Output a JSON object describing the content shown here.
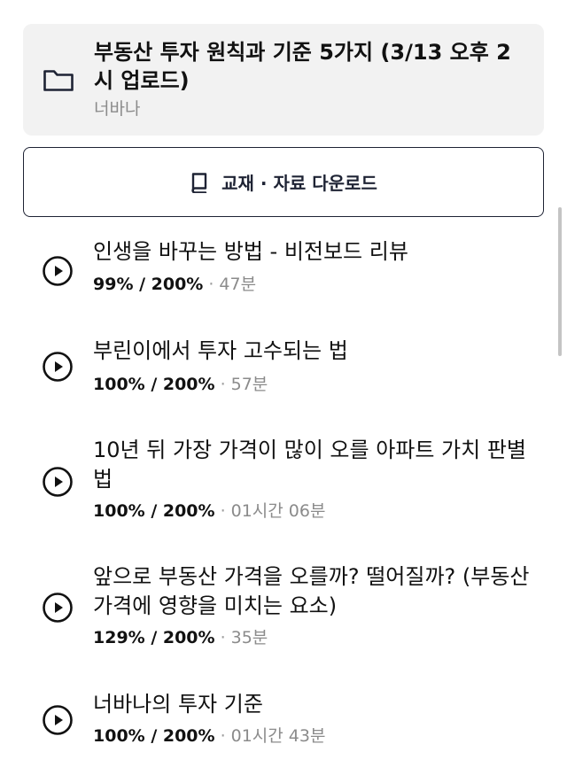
{
  "course": {
    "icon": "folder-icon",
    "title": "부동산 투자 원칙과 기준 5가지 (3/13 오후 2시 업로드)",
    "author": "너바나"
  },
  "download": {
    "icon": "book-icon",
    "label": "교재 · 자료 다운로드"
  },
  "lessons": [
    {
      "icon": "play-icon",
      "title": "인생을 바꾸는 방법 - 비전보드 리뷰",
      "progress": "99% / 200%",
      "separator": "·",
      "duration": "47분"
    },
    {
      "icon": "play-icon",
      "title": "부린이에서 투자 고수되는 법",
      "progress": "100% / 200%",
      "separator": "·",
      "duration": "57분"
    },
    {
      "icon": "play-icon",
      "title": "10년 뒤 가장 가격이 많이 오를 아파트 가치 판별법",
      "progress": "100% / 200%",
      "separator": "·",
      "duration": "01시간 06분"
    },
    {
      "icon": "play-icon",
      "title": "앞으로 부동산 가격을 오를까? 떨어질까? (부동산 가격에 영향을 미치는 요소)",
      "progress": "129% / 200%",
      "separator": "·",
      "duration": "35분"
    },
    {
      "icon": "play-icon",
      "title": "너바나의 투자 기준",
      "progress": "100% / 200%",
      "separator": "·",
      "duration": "01시간 43분"
    }
  ]
}
